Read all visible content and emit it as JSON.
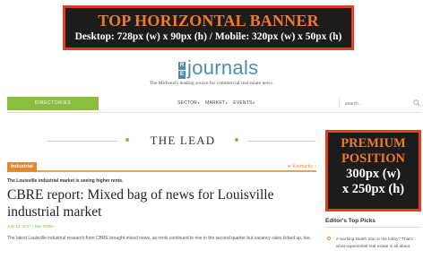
{
  "top_banner": {
    "title": "TOP HORIZONTAL BANNER",
    "subtitle": "Desktop: 728px (w) x 90px (h) / Mobile: 320px (w) x 50px (h)"
  },
  "brand": {
    "logo_prefix": [
      "R",
      "E"
    ],
    "logo_word": "journals",
    "tagline": "The Midwest's leading source for commercial real estate news.",
    "accent_color": "#4c8ea6"
  },
  "nav": {
    "directories_label": "DIRECTORIES",
    "links": [
      "SECTOR",
      "MARKET",
      "EVENTS"
    ],
    "search_placeholder": "search...",
    "directories_color": "#8bbd3c"
  },
  "section": {
    "title": "THE LEAD"
  },
  "premium": {
    "line1": "PREMIUM",
    "line2": "POSITION",
    "line3": "300px (w)",
    "line4": "x 250px (h)"
  },
  "article": {
    "category": "Industrial",
    "location": "Kentucky",
    "kicker": "The Louisville industrial market is seeing higher rents.",
    "headline": "CBRE report: Mixed bag of news for Louisville industrial market",
    "date": "July 13, 2017",
    "author": "Dan Rafter",
    "excerpt": "The latest Louisville industrial research from CBRE brought mixed news, as rents continued to rise in the second quarter but vacancy rates ticked up, too.",
    "category_color": "#e3892b"
  },
  "picks": {
    "title": "Editor's Top Picks",
    "items": [
      "A working Death Star in the lobby? That's what experiential real estate is all about."
    ]
  }
}
